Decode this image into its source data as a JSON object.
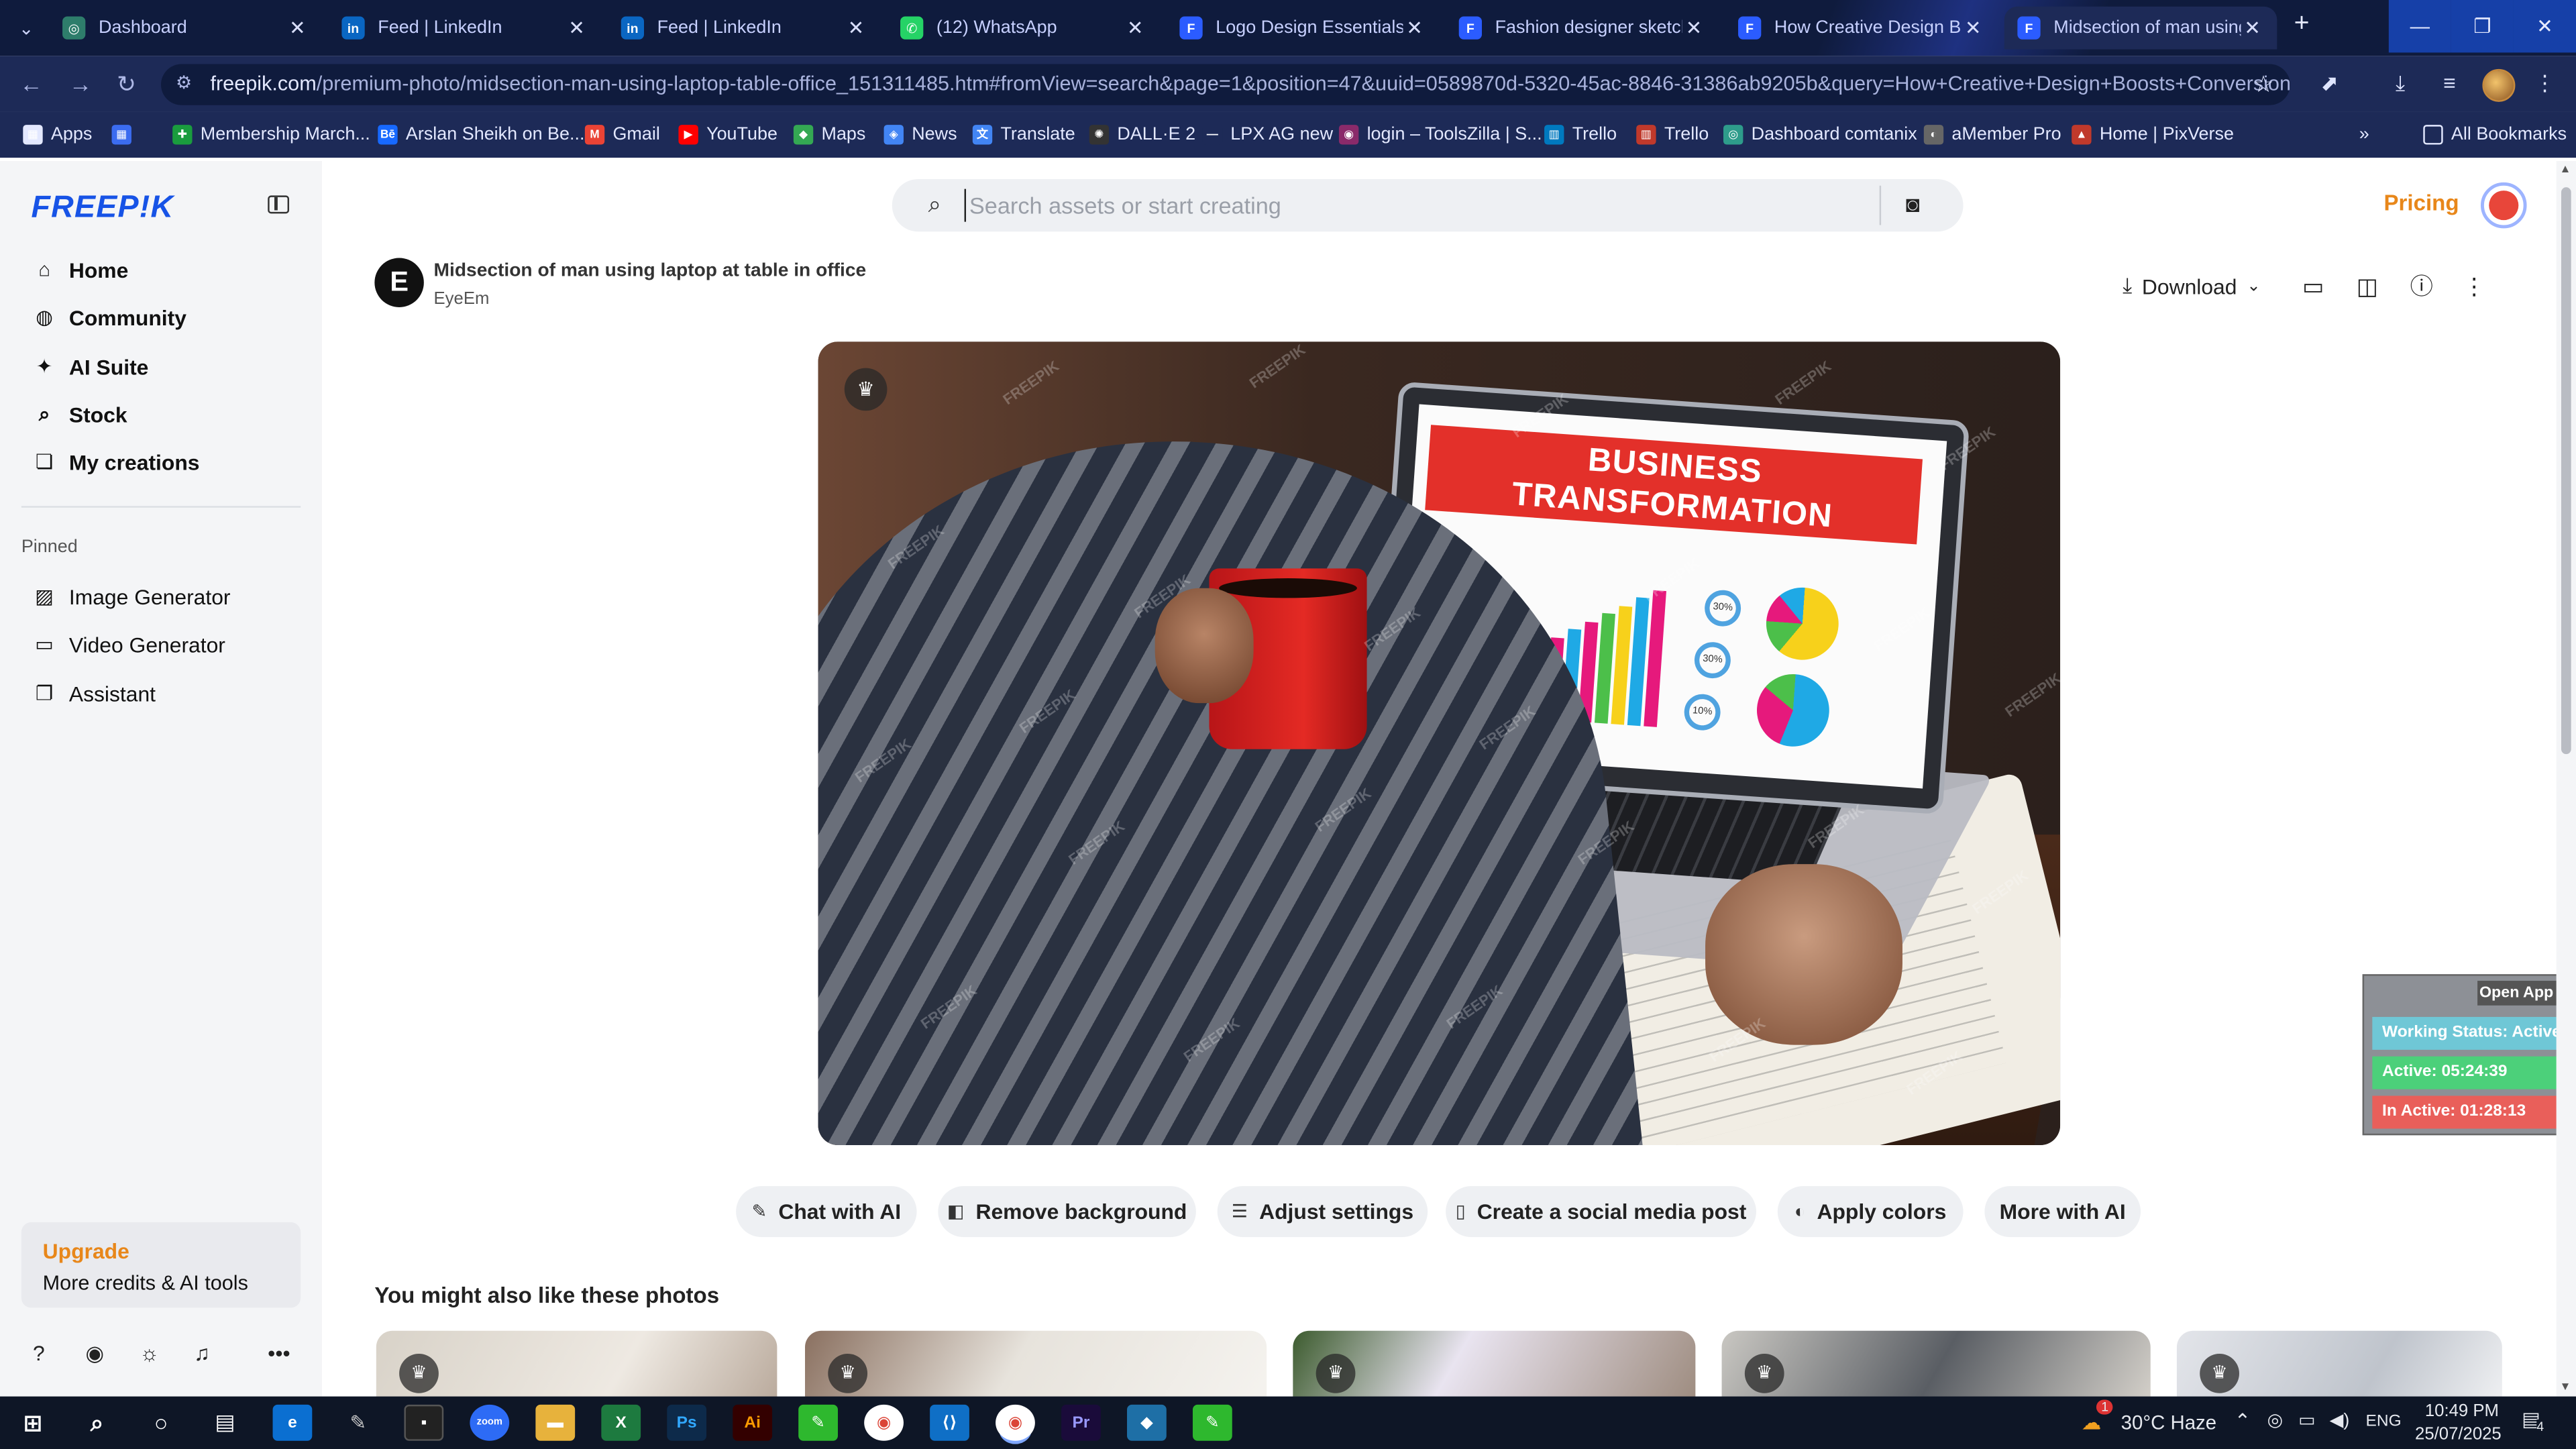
{
  "browser": {
    "tabs": [
      {
        "title": "Dashboard",
        "fav_bg": "#2e7d6b",
        "fav_glyph": "◎"
      },
      {
        "title": "Feed | LinkedIn",
        "fav_bg": "#0a66c2",
        "fav_glyph": "in"
      },
      {
        "title": "Feed | LinkedIn",
        "fav_bg": "#0a66c2",
        "fav_glyph": "in"
      },
      {
        "title": "(12) WhatsApp",
        "fav_bg": "#25d366",
        "fav_glyph": "✆"
      },
      {
        "title": "Logo Design Essentials: W",
        "fav_bg": "#2b5cff",
        "fav_glyph": "F"
      },
      {
        "title": "Fashion designer sketch d",
        "fav_bg": "#2b5cff",
        "fav_glyph": "F"
      },
      {
        "title": "How Creative Design Boo",
        "fav_bg": "#2b5cff",
        "fav_glyph": "F"
      },
      {
        "title": "Midsection of man using",
        "fav_bg": "#2b5cff",
        "fav_glyph": "F"
      }
    ],
    "close_glyph": "✕",
    "new_tab_glyph": "+",
    "url_host": "freepik.com",
    "url_path": "/premium-photo/midsection-man-using-laptop-table-office_151311485.htm#fromView=search&page=1&position=47&uuid=0589870d-5320-45ac-8846-31386ab9205b&query=How+Creative+Design+Boosts+Conversion+Rates+...",
    "bookmarks": [
      {
        "label": "Apps",
        "icon_bg": "#e3e8ff",
        "glyph": "▦"
      },
      {
        "label": "",
        "icon_bg": "#3b6cf0",
        "glyph": "▦"
      },
      {
        "label": "Membership March...",
        "icon_bg": "#1a9c3e",
        "glyph": "✚"
      },
      {
        "label": "Arslan Sheikh on Be...",
        "icon_bg": "#1769ff",
        "glyph": "Bē"
      },
      {
        "label": "Gmail",
        "icon_bg": "#ea4335",
        "glyph": "M"
      },
      {
        "label": "YouTube",
        "icon_bg": "#ff0000",
        "glyph": "▶"
      },
      {
        "label": "Maps",
        "icon_bg": "#34a853",
        "glyph": "◆"
      },
      {
        "label": "News",
        "icon_bg": "#4285f4",
        "glyph": "◈"
      },
      {
        "label": "Translate",
        "icon_bg": "#4285f4",
        "glyph": "文"
      },
      {
        "label": "DALL·E 2",
        "icon_bg": "#333333",
        "glyph": "✺"
      },
      {
        "label": "LPX AG new",
        "icon_bg": "#1d2a57",
        "glyph": "—"
      },
      {
        "label": "login – ToolsZilla | S...",
        "icon_bg": "#8a2a6a",
        "glyph": "◉"
      },
      {
        "label": "Trello",
        "icon_bg": "#0079bf",
        "glyph": "▥"
      },
      {
        "label": "Trello",
        "icon_bg": "#c0392b",
        "glyph": "▥"
      },
      {
        "label": "Dashboard comtanix",
        "icon_bg": "#2e9c8b",
        "glyph": "◎"
      },
      {
        "label": "aMember Pro",
        "icon_bg": "#666666",
        "glyph": "◐"
      },
      {
        "label": "Home | PixVerse",
        "icon_bg": "#c0392b",
        "glyph": "▲"
      }
    ],
    "bookmarks_more": "»",
    "all_bookmarks": "All Bookmarks"
  },
  "sidebar": {
    "logo": "FREEP!K",
    "nav": [
      {
        "label": "Home",
        "icon": "⌂"
      },
      {
        "label": "Community",
        "icon": "◍"
      },
      {
        "label": "AI Suite",
        "icon": "✦"
      },
      {
        "label": "Stock",
        "icon": "⌕"
      },
      {
        "label": "My creations",
        "icon": "❏"
      }
    ],
    "pinned_label": "Pinned",
    "pinned": [
      {
        "label": "Image Generator",
        "icon": "▨"
      },
      {
        "label": "Video Generator",
        "icon": "▭"
      },
      {
        "label": "Assistant",
        "icon": "❐"
      }
    ],
    "upgrade_title": "Upgrade",
    "upgrade_sub": "More credits & AI tools",
    "footer_icons": [
      "?",
      "◉",
      "☼",
      "♫",
      "•••"
    ]
  },
  "header": {
    "search_placeholder": "Search assets or start creating",
    "pricing": "Pricing"
  },
  "asset": {
    "badge": "E",
    "title": "Midsection of man using laptop at table in office",
    "author": "EyeEm",
    "download_label": "Download",
    "screen_banner": "BUSINESS TRANSFORMATION",
    "pct_labels": [
      "30%",
      "30%",
      "10%"
    ],
    "watermark": "FREEPIK"
  },
  "actions": [
    {
      "label": "Chat with AI",
      "icon": "✎"
    },
    {
      "label": "Remove background",
      "icon": "◧"
    },
    {
      "label": "Adjust settings",
      "icon": "☰"
    },
    {
      "label": "Create a social media post",
      "icon": "▯"
    },
    {
      "label": "Apply colors",
      "icon": "◐"
    },
    {
      "label": "More with AI",
      "icon": ""
    }
  ],
  "related_title": "You might also like these photos",
  "widget": {
    "open_app": "Open App ↗",
    "status": "Working Status: Active",
    "active": "Active: 05:24:39",
    "inactive": "In Active: 01:28:13",
    "status_color": "#6fc7d6",
    "active_color": "#4cd07a",
    "inactive_color": "#e95f5a"
  },
  "taskbar": {
    "weather": "30°C  Haze",
    "weather_badge": "1",
    "lang": "ENG",
    "time": "10:49 PM",
    "date": "25/07/2025",
    "notif_count": "4"
  }
}
